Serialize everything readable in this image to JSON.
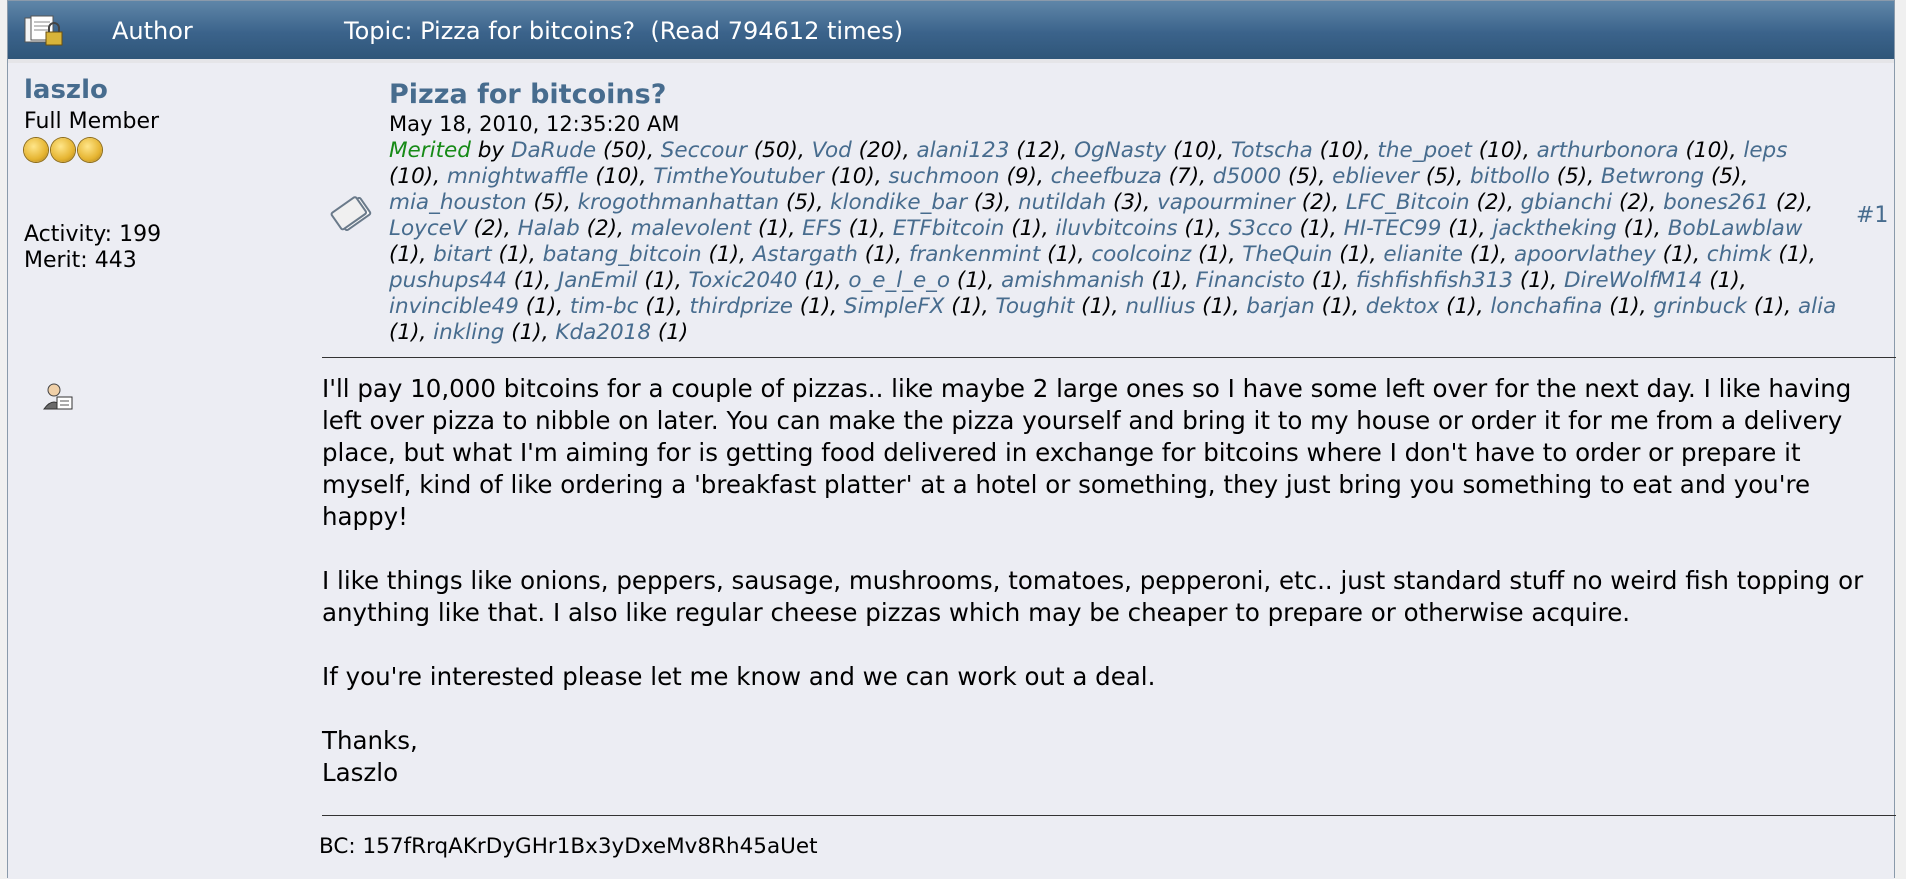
{
  "header": {
    "author_label": "Author",
    "topic_label": "Topic: Pizza for bitcoins?  (Read 794612 times)"
  },
  "user": {
    "name": "laszlo",
    "rank": "Full Member",
    "stars": 3,
    "activity": "Activity: 199",
    "merit": "Merit: 443"
  },
  "post": {
    "subject": "Pizza for bitcoins?",
    "date": "May 18, 2010, 12:35:20 AM",
    "number": "#1",
    "merited_label": "Merited",
    "by_label": "by",
    "merits": [
      {
        "name": "DaRude",
        "count": "(50)"
      },
      {
        "name": "Seccour",
        "count": "(50)"
      },
      {
        "name": "Vod",
        "count": "(20)"
      },
      {
        "name": "alani123",
        "count": "(12)"
      },
      {
        "name": "OgNasty",
        "count": "(10)"
      },
      {
        "name": "Totscha",
        "count": "(10)"
      },
      {
        "name": "the_poet",
        "count": "(10)"
      },
      {
        "name": "arthurbonora",
        "count": "(10)"
      },
      {
        "name": "leps",
        "count": "(10)"
      },
      {
        "name": "mnightwaffle",
        "count": "(10)"
      },
      {
        "name": "TimtheYoutuber",
        "count": "(10)"
      },
      {
        "name": "suchmoon",
        "count": "(9)"
      },
      {
        "name": "cheefbuza",
        "count": "(7)"
      },
      {
        "name": "d5000",
        "count": "(5)"
      },
      {
        "name": "ebliever",
        "count": "(5)"
      },
      {
        "name": "bitbollo",
        "count": "(5)"
      },
      {
        "name": "Betwrong",
        "count": "(5)"
      },
      {
        "name": "mia_houston",
        "count": "(5)"
      },
      {
        "name": "krogothmanhattan",
        "count": "(5)"
      },
      {
        "name": "klondike_bar",
        "count": "(3)"
      },
      {
        "name": "nutildah",
        "count": "(3)"
      },
      {
        "name": "vapourminer",
        "count": "(2)"
      },
      {
        "name": "LFC_Bitcoin",
        "count": "(2)"
      },
      {
        "name": "gbianchi",
        "count": "(2)"
      },
      {
        "name": "bones261",
        "count": "(2)"
      },
      {
        "name": "LoyceV",
        "count": "(2)"
      },
      {
        "name": "Halab",
        "count": "(2)"
      },
      {
        "name": "malevolent",
        "count": "(1)"
      },
      {
        "name": "EFS",
        "count": "(1)"
      },
      {
        "name": "ETFbitcoin",
        "count": "(1)"
      },
      {
        "name": "iluvbitcoins",
        "count": "(1)"
      },
      {
        "name": "S3cco",
        "count": "(1)"
      },
      {
        "name": "HI-TEC99",
        "count": "(1)"
      },
      {
        "name": "jacktheking",
        "count": "(1)"
      },
      {
        "name": "BobLawblaw",
        "count": "(1)"
      },
      {
        "name": "bitart",
        "count": "(1)"
      },
      {
        "name": "batang_bitcoin",
        "count": "(1)"
      },
      {
        "name": "Astargath",
        "count": "(1)"
      },
      {
        "name": "frankenmint",
        "count": "(1)"
      },
      {
        "name": "coolcoinz",
        "count": "(1)"
      },
      {
        "name": "TheQuin",
        "count": "(1)"
      },
      {
        "name": "elianite",
        "count": "(1)"
      },
      {
        "name": "apoorvlathey",
        "count": "(1)"
      },
      {
        "name": "chimk",
        "count": "(1)"
      },
      {
        "name": "pushups44",
        "count": "(1)"
      },
      {
        "name": "JanEmil",
        "count": "(1)"
      },
      {
        "name": "Toxic2040",
        "count": "(1)"
      },
      {
        "name": "o_e_l_e_o",
        "count": "(1)"
      },
      {
        "name": "amishmanish",
        "count": "(1)"
      },
      {
        "name": "Financisto",
        "count": "(1)"
      },
      {
        "name": "fishfishfish313",
        "count": "(1)"
      },
      {
        "name": "DireWolfM14",
        "count": "(1)"
      },
      {
        "name": "invincible49",
        "count": "(1)"
      },
      {
        "name": "tim-bc",
        "count": "(1)"
      },
      {
        "name": "thirdprize",
        "count": "(1)"
      },
      {
        "name": "SimpleFX",
        "count": "(1)"
      },
      {
        "name": "Toughit",
        "count": "(1)"
      },
      {
        "name": "nullius",
        "count": "(1)"
      },
      {
        "name": "barjan",
        "count": "(1)"
      },
      {
        "name": "dektox",
        "count": "(1)"
      },
      {
        "name": "lonchafina",
        "count": "(1)"
      },
      {
        "name": "grinbuck",
        "count": "(1)"
      },
      {
        "name": "alia",
        "count": "(1)"
      },
      {
        "name": "inkling",
        "count": "(1)"
      },
      {
        "name": "Kda2018",
        "count": "(1)"
      }
    ],
    "body": [
      "I'll pay 10,000 bitcoins for a couple of pizzas.. like maybe 2 large ones so I have some left over for the next day.  I like having left over pizza to nibble on later.  You can make the pizza yourself and bring it to my house or order it for me from a delivery place, but what I'm aiming for is getting food delivered in exchange for bitcoins where I don't have to order or prepare it myself, kind of like ordering a 'breakfast platter' at a hotel or something, they just bring you something to eat and you're happy!",
      "I like things like onions, peppers, sausage, mushrooms, tomatoes, pepperoni, etc.. just standard stuff no weird fish topping or anything like that.  I also like regular cheese pizzas which may be cheaper to prepare or otherwise acquire.",
      "If you're interested please let me know and we can work out a deal.",
      "Thanks,\nLaszlo"
    ],
    "signature": "BC: 157fRrqAKrDyGHr1Bx3yDxeMv8Rh45aUet"
  },
  "colors": {
    "header_bg": "#3b638b",
    "link": "#476c8e",
    "merited": "#168a16",
    "post_bg": "#ecedf3"
  },
  "icons": {
    "header": "topic-locked-icon",
    "post": "post-xx-icon",
    "profile": "profile-user-icon"
  }
}
